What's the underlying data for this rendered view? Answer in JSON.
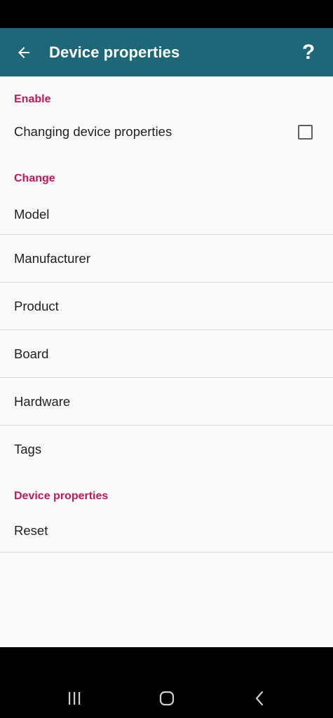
{
  "app_bar": {
    "title": "Device properties",
    "back_icon": "arrow-left-icon",
    "help_label": "?",
    "background": "#1e6778"
  },
  "sections": {
    "enable": {
      "header": "Enable",
      "items": [
        {
          "label": "Changing device properties",
          "checked": false
        }
      ]
    },
    "change": {
      "header": "Change",
      "items": [
        {
          "label": "Model"
        },
        {
          "label": "Manufacturer"
        },
        {
          "label": "Product"
        },
        {
          "label": "Board"
        },
        {
          "label": "Hardware"
        },
        {
          "label": "Tags"
        }
      ]
    },
    "device_properties": {
      "header": "Device properties",
      "items": [
        {
          "label": "Reset"
        }
      ]
    }
  },
  "colors": {
    "accent": "#c2185b",
    "text": "#212121",
    "content_bg": "#fafafa"
  },
  "nav_bar": {
    "recents_icon": "recents-icon",
    "home_icon": "home-icon",
    "back_icon": "nav-back-icon"
  }
}
